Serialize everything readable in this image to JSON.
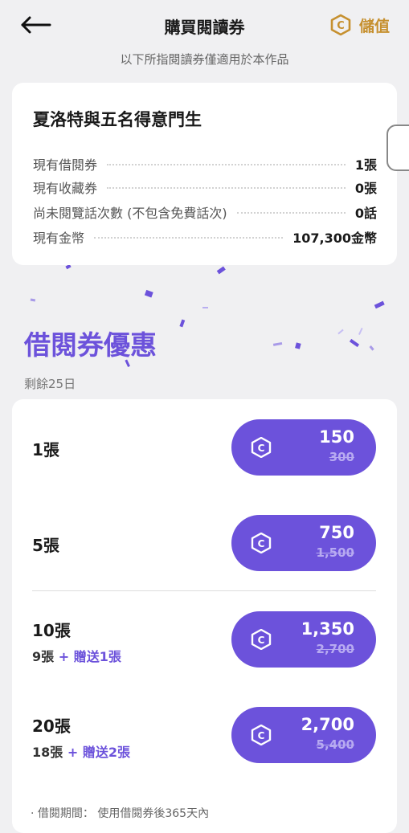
{
  "header": {
    "title": "購買閱讀券",
    "topup_label": "儲值"
  },
  "subtitle": "以下所指閱讀券僅適用於本作品",
  "work": {
    "title": "夏洛特與五名得意門生",
    "rows": [
      {
        "label": "現有借閱券",
        "value": "1張"
      },
      {
        "label": "現有收藏券",
        "value": "0張"
      },
      {
        "label": "尚未閱覽話次數 (不包含免費話次)",
        "value": "0話"
      },
      {
        "label": "現有金幣",
        "value": "107,300金幣"
      }
    ]
  },
  "promo": {
    "title": "借閱券優惠",
    "remaining": "剩餘25日"
  },
  "offers": [
    {
      "qty": "1張",
      "base": "",
      "bonus": "",
      "price": "150",
      "old_price": "300"
    },
    {
      "qty": "5張",
      "base": "",
      "bonus": "",
      "price": "750",
      "old_price": "1,500"
    },
    {
      "qty": "10張",
      "base": "9張",
      "bonus": " + 贈送1張",
      "price": "1,350",
      "old_price": "2,700"
    },
    {
      "qty": "20張",
      "base": "18張",
      "bonus": " + 贈送2張",
      "price": "2,700",
      "old_price": "5,400"
    }
  ],
  "footnote": "· 借閱期間： 使用借閱券後365天內",
  "colors": {
    "accent": "#6c52db",
    "gold": "#c6902f"
  },
  "icons": {
    "back": "back-arrow-icon",
    "coin": "coin-icon"
  }
}
